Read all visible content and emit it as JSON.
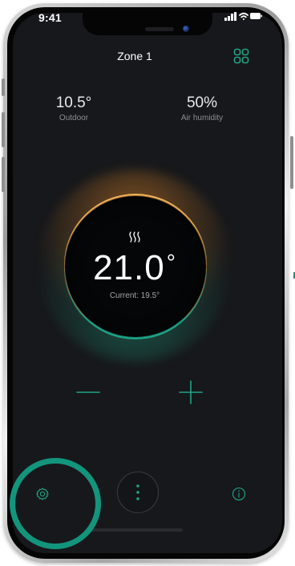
{
  "status_bar": {
    "time": "9:41"
  },
  "header": {
    "title": "Zone 1",
    "grid_icon": "grid-icon"
  },
  "stats": {
    "outdoor": {
      "value": "10.5°",
      "label": "Outdoor"
    },
    "humidity": {
      "value": "50%",
      "label": "Air humidity"
    }
  },
  "dial": {
    "mode_icon": "heat-icon",
    "setpoint": "21.0",
    "degree_symbol": "°",
    "current": "Current: 19.5°"
  },
  "controls": {
    "minus_icon": "minus-icon",
    "plus_icon": "plus-icon"
  },
  "bottom_bar": {
    "settings_icon": "gear-icon",
    "menu_icon": "more-vertical-icon",
    "info_icon": "info-icon"
  },
  "colors": {
    "background": "#17181b",
    "accent": "#1ea487",
    "warm_glow": "#f2b45a",
    "highlight": "#12957c"
  }
}
